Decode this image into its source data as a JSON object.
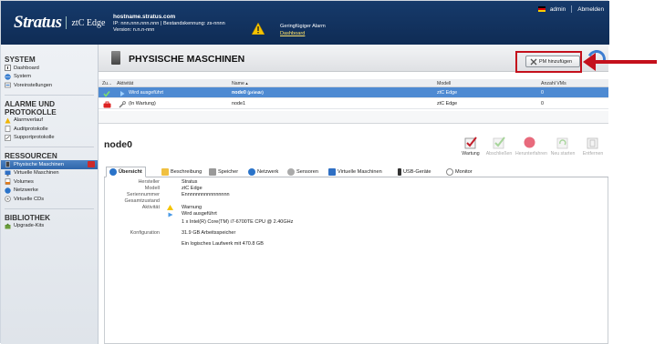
{
  "header": {
    "logo_main": "Stratus",
    "logo_sub": "ztC Edge",
    "hostname": "hostname.stratus.com",
    "ip_line": "IP: nnn.nnn.nnn.nnn | Bestandskennung: zs-nnnn",
    "version_line": "Version: n.n.n-nnn",
    "alarm_text": "Geringfügiger Alarm",
    "alarm_link": "Dashboard",
    "user": "admin",
    "logout": "Abmelden"
  },
  "sidebar": {
    "system_title": "SYSTEM",
    "system_items": [
      {
        "label": "Dashboard"
      },
      {
        "label": "System"
      },
      {
        "label": "Voreinstellungen"
      }
    ],
    "alarms_title_1": "ALARME UND",
    "alarms_title_2": "PROTOKOLLE",
    "alarm_items": [
      {
        "label": "Alarmverlauf"
      },
      {
        "label": "Auditprotokolle"
      },
      {
        "label": "Supportprotokolle"
      }
    ],
    "resources_title": "RESSOURCEN",
    "resource_items": [
      {
        "label": "Physische Maschinen"
      },
      {
        "label": "Virtuelle Maschinen"
      },
      {
        "label": "Volumes"
      },
      {
        "label": "Netzwerke"
      },
      {
        "label": "Virtuelle CDs"
      }
    ],
    "library_title": "BIBLIOTHEK",
    "library_items": [
      {
        "label": "Upgrade-Kits"
      }
    ]
  },
  "main": {
    "title": "PHYSISCHE MASCHINEN",
    "add_button": "PM hinzufügen",
    "columns": [
      "Zu...",
      "Aktivität",
      "Name ▴",
      "Modell",
      "Anzahl VMs"
    ],
    "rows": [
      {
        "activity": "Wird ausgeführt",
        "name": "node0",
        "name_suffix": "(primär)",
        "model": "ztC Edge",
        "vms": "0"
      },
      {
        "activity": "(In Wartung)",
        "name": "node1",
        "name_suffix": "",
        "model": "ztC Edge",
        "vms": "0"
      }
    ],
    "node_title": "node0",
    "actions": [
      "Wartung",
      "Abschließen",
      "Herunterfahren",
      "Neu starten",
      "Entfernen"
    ],
    "tabs": [
      "Übersicht",
      "Beschreibung",
      "Speicher",
      "Netzwerk",
      "Sensoren",
      "Virtuelle Maschinen",
      "USB-Geräte",
      "Monitor"
    ],
    "details": {
      "hersteller_k": "Hersteller",
      "hersteller_v": "Stratus",
      "modell_k": "Modell",
      "modell_v": "ztC Edge",
      "serien_k": "Seriennummer",
      "serien_v": "Ennnnnnnnnnnnnnnn",
      "gesamt_k": "Gesamtzustand",
      "gesamt_v": "Warnung",
      "aktiv_k": "Aktivität",
      "aktiv_v": "Wird ausgeführt",
      "cpu_v": "1 x Intel(R) Core(TM) i7-6700TE CPU @ 2.40GHz",
      "konf_k": "Konfiguration",
      "mem_v": "31.9 GB Arbeitsspeicher",
      "disk_v": "Ein logisches Laufwerk mit 470.8 GB"
    }
  },
  "colors": {
    "header_bg": "#163a6b",
    "selected_row": "#4e8ad2",
    "annotation": "#c4101c"
  }
}
